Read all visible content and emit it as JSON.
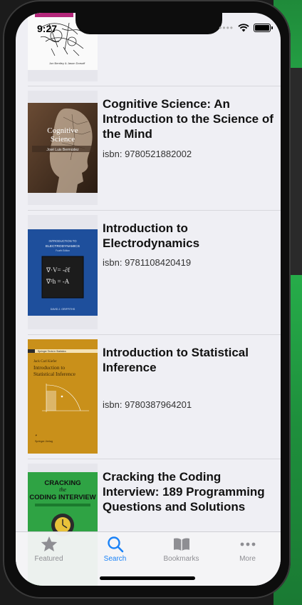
{
  "status": {
    "time": "9:27"
  },
  "partial_book": {
    "authors": "Jon Bentley & Jason Dorsoff"
  },
  "books": [
    {
      "title": "Cognitive Science: An Introduction to the Science of the Mind",
      "isbn": "isbn: 9780521882002",
      "cover_title": "Cognitive Science",
      "cover_author": "José Luis Bermúdez"
    },
    {
      "title": "Introduction to Electrodynamics",
      "isbn": "isbn: 9781108420419",
      "cover_title": "INTRODUCTION TO ELECTRODYNAMICS",
      "cover_author": "DAVID J. GRIFFITHS"
    },
    {
      "title": "Introduction to Statistical Inference",
      "isbn": "isbn: 9780387964201",
      "cover_series": "Springer Texts in Statistics",
      "cover_author": "Jack Carl Kiefer",
      "cover_title": "Introduction to Statistical Inference",
      "cover_publisher": "Springer-Verlag"
    },
    {
      "title": "Cracking the Coding Interview: 189 Programming Questions and Solutions",
      "cover_title_1": "CRACKING",
      "cover_title_2": "the",
      "cover_title_3": "CODING INTERVIEW"
    }
  ],
  "tabs": [
    {
      "label": "Featured",
      "icon": "star-icon"
    },
    {
      "label": "Search",
      "icon": "search-icon"
    },
    {
      "label": "Bookmarks",
      "icon": "book-open-icon"
    },
    {
      "label": "More",
      "icon": "more-icon"
    }
  ],
  "colors": {
    "accent": "#1a82f7",
    "inactive": "#8e8e93"
  }
}
